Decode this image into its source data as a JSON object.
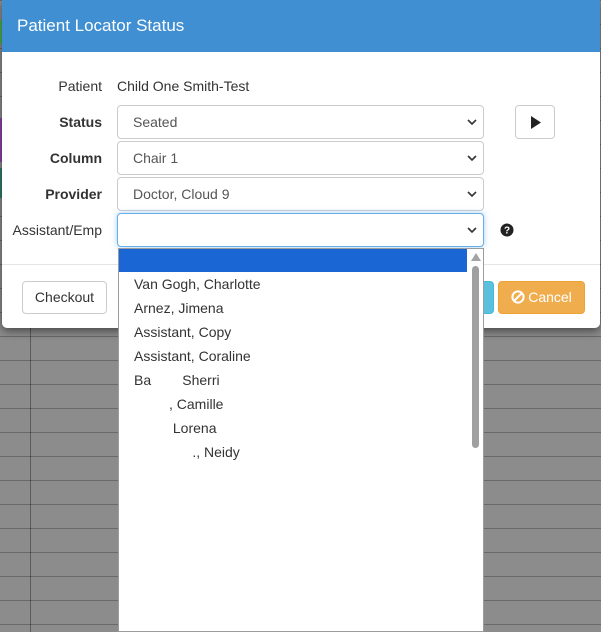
{
  "modal": {
    "title": "Patient Locator Status"
  },
  "form": {
    "patient_label": "Patient",
    "patient_value": "Child One Smith-Test",
    "status_label": "Status",
    "status_value": "Seated",
    "column_label": "Column",
    "column_value": "Chair 1",
    "provider_label": "Provider",
    "provider_value": "Doctor, Cloud 9",
    "assistant_label": "Assistant/Emp",
    "assistant_value": ""
  },
  "footer": {
    "checkout_label": "Checkout",
    "cancel_label": "Cancel"
  },
  "assistant_options": [
    "",
    "Van Gogh, Charlotte",
    "Arnez, Jimena",
    "Assistant, Copy",
    "Assistant, Coraline",
    "Ba        Sherri",
    "         , Camille",
    "          Lorena",
    "               ., Neidy"
  ],
  "colors": {
    "header_bg": "#3f8fd2",
    "cancel_bg": "#f0ad4e",
    "selected_option_bg": "#1a66d4"
  }
}
